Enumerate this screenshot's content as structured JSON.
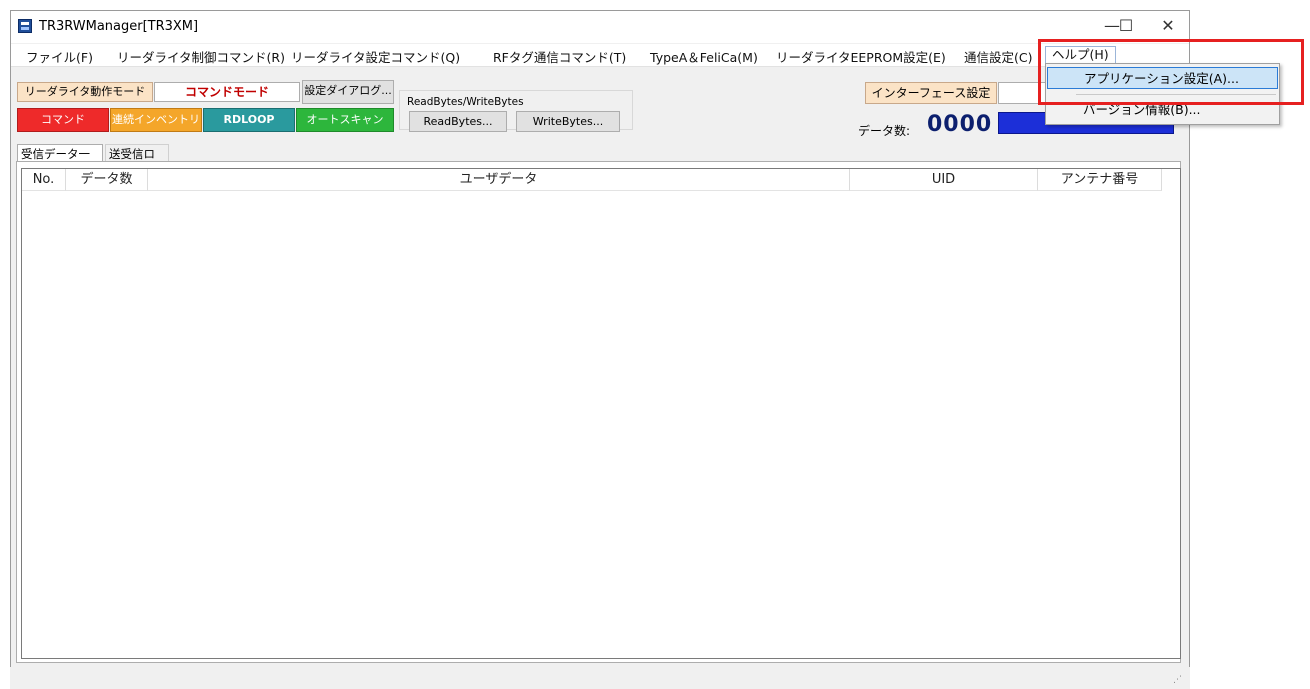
{
  "window": {
    "title": "TR3RWManager[TR3XM]"
  },
  "titlebar": {
    "minimize": "—",
    "maximize": "☐",
    "close": "✕"
  },
  "menu": {
    "file": "ファイル(F)",
    "control": "リーダライタ制御コマンド(R)",
    "setting": "リーダライタ設定コマンド(Q)",
    "rftag": "RFタグ通信コマンド(T)",
    "typea": "TypeA＆FeliCa(M)",
    "eeprom": "リーダライタEEPROM設定(E)",
    "comm": "通信設定(C)",
    "help": "ヘルプ(H)"
  },
  "toolbar": {
    "mode_label": "リーダライタ動作モード",
    "mode_value": "コマンドモード",
    "settings_dialog": "設定ダイアログ...",
    "command": "コマンド",
    "continuous_inventory": "連続インベントリ",
    "rdloop": "RDLOOP",
    "auto_scan": "オートスキャン",
    "group_title": "ReadBytes/WriteBytes",
    "read_bytes": "ReadBytes...",
    "write_bytes": "WriteBytes...",
    "interface_settings": "インターフェース設定",
    "data_count_label": "データ数:",
    "data_count_value": "0000"
  },
  "tabs": {
    "received_list": "受信データ一覧",
    "comm_log": "送受信ログ"
  },
  "table": {
    "columns": [
      "No.",
      "データ数",
      "ユーザデータ",
      "UID",
      "アンテナ番号"
    ]
  },
  "help_menu": {
    "items": [
      "アプリケーション設定(A)...",
      "バージョン情報(B)..."
    ]
  },
  "colors": {
    "command": "#ee2a2a",
    "continuous_inventory": "#f4a62a",
    "rdloop": "#2a9a9e",
    "auto_scan": "#2db63c",
    "highlight_box": "#e62020"
  }
}
